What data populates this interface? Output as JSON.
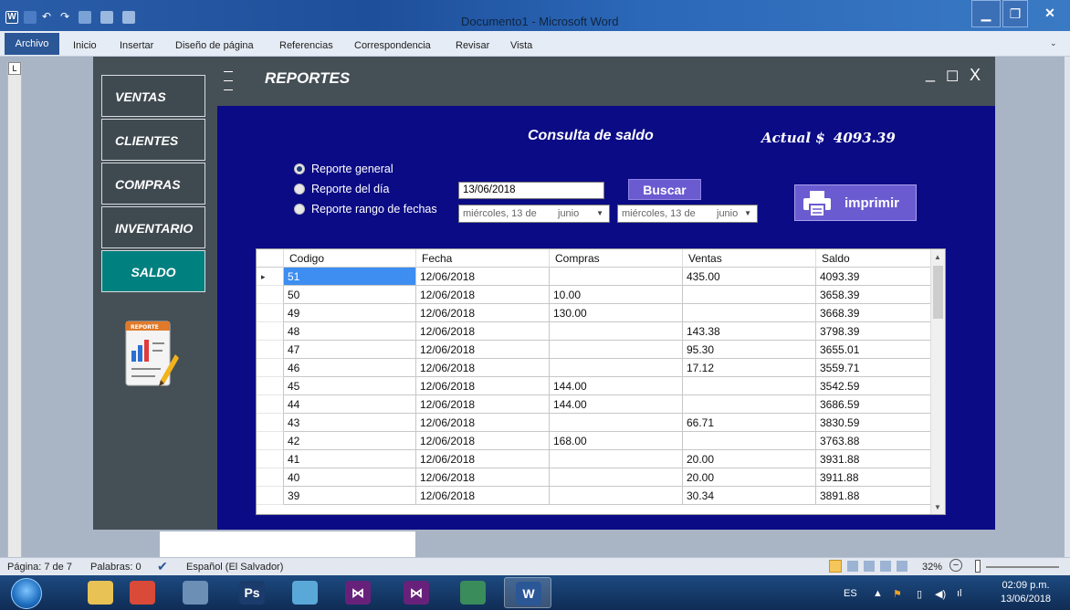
{
  "word": {
    "title": "Documento1 - Microsoft Word",
    "tabs": [
      "Archivo",
      "Inicio",
      "Insertar",
      "Diseño de página",
      "Referencias",
      "Correspondencia",
      "Revisar",
      "Vista"
    ],
    "ruler_corner": "L"
  },
  "app": {
    "header_title": "REPORTES",
    "minimize": "_",
    "maximize": "☐",
    "close": "X",
    "sidebar": [
      {
        "label": "VENTAS",
        "active": false
      },
      {
        "label": "CLIENTES",
        "active": false
      },
      {
        "label": "COMPRAS",
        "active": false
      },
      {
        "label": "INVENTARIO",
        "active": false
      },
      {
        "label": "SALDO",
        "active": true
      }
    ],
    "report_icon_text": "REPORTE",
    "consulta_title": "Consulta de saldo",
    "actual_label": "Actual $",
    "actual_value": "4093.39",
    "radios": [
      {
        "label": "Reporte general",
        "checked": true
      },
      {
        "label": "Reporte del día",
        "checked": false
      },
      {
        "label": "Reporte rango de fechas",
        "checked": false
      }
    ],
    "date_input_value": "13/06/2018",
    "buscar_label": "Buscar",
    "date_from": {
      "day": "miércoles, 13 de",
      "month": "junio"
    },
    "date_to": {
      "day": "miércoles, 13 de",
      "month": "junio"
    },
    "print_label": "imprimir",
    "grid": {
      "columns": [
        "Codigo",
        "Fecha",
        "Compras",
        "Ventas",
        "Saldo"
      ],
      "rows": [
        [
          "51",
          "12/06/2018",
          "",
          "435.00",
          "4093.39"
        ],
        [
          "50",
          "12/06/2018",
          "10.00",
          "",
          "3658.39"
        ],
        [
          "49",
          "12/06/2018",
          "130.00",
          "",
          "3668.39"
        ],
        [
          "48",
          "12/06/2018",
          "",
          "143.38",
          "3798.39"
        ],
        [
          "47",
          "12/06/2018",
          "",
          "95.30",
          "3655.01"
        ],
        [
          "46",
          "12/06/2018",
          "",
          "17.12",
          "3559.71"
        ],
        [
          "45",
          "12/06/2018",
          "144.00",
          "",
          "3542.59"
        ],
        [
          "44",
          "12/06/2018",
          "144.00",
          "",
          "3686.59"
        ],
        [
          "43",
          "12/06/2018",
          "",
          "66.71",
          "3830.59"
        ],
        [
          "42",
          "12/06/2018",
          "168.00",
          "",
          "3763.88"
        ],
        [
          "41",
          "12/06/2018",
          "",
          "20.00",
          "3931.88"
        ],
        [
          "40",
          "12/06/2018",
          "",
          "20.00",
          "3911.88"
        ],
        [
          "39",
          "12/06/2018",
          "",
          "30.34",
          "3891.88"
        ]
      ],
      "selected_row": 0
    }
  },
  "statusbar": {
    "page": "Página: 7 de 7",
    "words": "Palabras: 0",
    "language": "Español (El Salvador)",
    "zoom": "32%"
  },
  "taskbar": {
    "apps": [
      {
        "name": "explorer-icon",
        "glyph": "",
        "color": "#e8c254"
      },
      {
        "name": "chrome-icon",
        "glyph": "",
        "color": "#d94a38"
      },
      {
        "name": "tool-icon",
        "glyph": "",
        "color": "#6b8fb5"
      },
      {
        "name": "photoshop-icon",
        "glyph": "Ps",
        "color": "#1a3b6b"
      },
      {
        "name": "box-icon",
        "glyph": "",
        "color": "#5aa8d8"
      },
      {
        "name": "visual-studio-icon",
        "glyph": "⋈",
        "color": "#68217a"
      },
      {
        "name": "visual-studio-2-icon",
        "glyph": "⋈",
        "color": "#68217a"
      },
      {
        "name": "app-icon",
        "glyph": "",
        "color": "#3a8c5a"
      },
      {
        "name": "word-icon",
        "glyph": "W",
        "color": "#2b5797"
      }
    ],
    "lang": "ES",
    "time": "02:09 p.m.",
    "date": "13/06/2018"
  }
}
